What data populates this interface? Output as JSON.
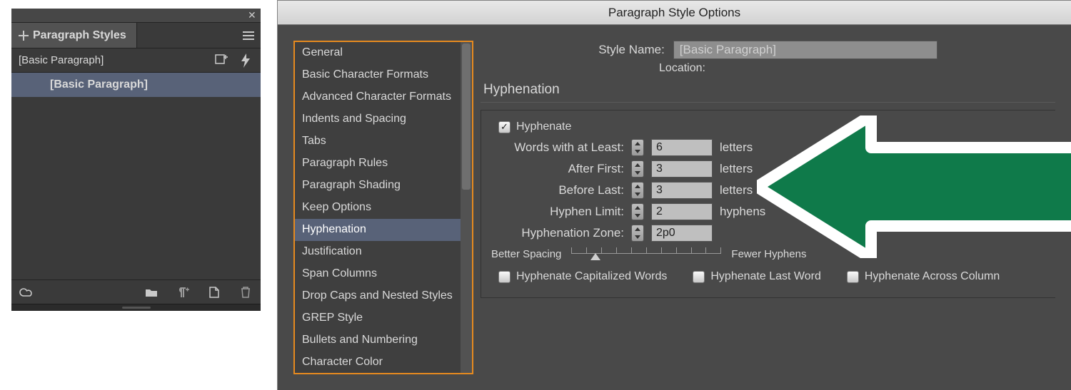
{
  "left_panel": {
    "tab_title": "Paragraph Styles",
    "header_label": "[Basic Paragraph]",
    "selected_style": "[Basic Paragraph]"
  },
  "dialog": {
    "title": "Paragraph Style Options",
    "style_name_label": "Style Name:",
    "style_name_value": "[Basic Paragraph]",
    "location_label": "Location:",
    "section_title": "Hyphenation"
  },
  "categories": [
    "General",
    "Basic Character Formats",
    "Advanced Character Formats",
    "Indents and Spacing",
    "Tabs",
    "Paragraph Rules",
    "Paragraph Shading",
    "Keep Options",
    "Hyphenation",
    "Justification",
    "Span Columns",
    "Drop Caps and Nested Styles",
    "GREP Style",
    "Bullets and Numbering",
    "Character Color"
  ],
  "selected_category_index": 8,
  "hyphenation": {
    "hyphenate_label": "Hyphenate",
    "hyphenate_checked": true,
    "rows": [
      {
        "label": "Words with at Least:",
        "value": "6",
        "unit": "letters"
      },
      {
        "label": "After First:",
        "value": "3",
        "unit": "letters"
      },
      {
        "label": "Before Last:",
        "value": "3",
        "unit": "letters"
      },
      {
        "label": "Hyphen Limit:",
        "value": "2",
        "unit": "hyphens"
      },
      {
        "label": "Hyphenation Zone:",
        "value": "2p0",
        "unit": ""
      }
    ],
    "slider": {
      "left_caption": "Better Spacing",
      "right_caption": "Fewer Hyphens"
    },
    "options": [
      {
        "label": "Hyphenate Capitalized Words",
        "checked": false
      },
      {
        "label": "Hyphenate Last Word",
        "checked": false
      },
      {
        "label": "Hyphenate Across Column",
        "checked": false
      }
    ]
  }
}
